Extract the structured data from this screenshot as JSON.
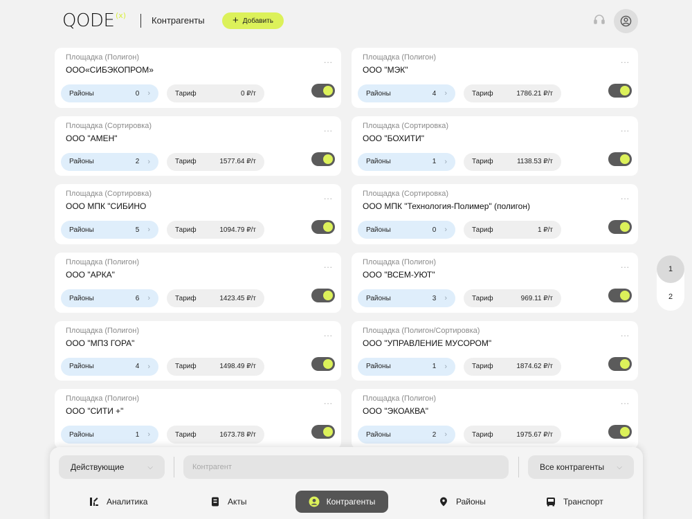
{
  "header": {
    "logo_text": "QODE",
    "logo_sup": "(x)",
    "title": "Контрагенты",
    "add_label": "Добавить"
  },
  "colors": {
    "accent": "#dcf15a",
    "toggle_track": "#5b5b5b",
    "districts_bg": "#dfeefb",
    "tariff_bg": "#efefef",
    "nav_active": "#555555"
  },
  "card_labels": {
    "districts": "Районы",
    "tariff": "Тариф",
    "more": "..."
  },
  "cards": [
    {
      "type": "Площадка (Полигон)",
      "name": "ООО«СИБЭКОПРОМ»",
      "districts": "0",
      "tariff": "0 ₽/т",
      "active": true
    },
    {
      "type": "Площадка (Полигон)",
      "name": "ООО \"МЭК\"",
      "districts": "4",
      "tariff": "1786.21 ₽/т",
      "active": true
    },
    {
      "type": "Площадка (Сортировка)",
      "name": "ООО \"АМЕН\"",
      "districts": "2",
      "tariff": "1577.64 ₽/т",
      "active": true
    },
    {
      "type": "Площадка (Сортировка)",
      "name": "ООО \"БОХИТИ\"",
      "districts": "1",
      "tariff": "1138.53 ₽/т",
      "active": true
    },
    {
      "type": "Площадка (Сортировка)",
      "name": "ООО МПК \"СИБИНО",
      "districts": "5",
      "tariff": "1094.79 ₽/т",
      "active": true
    },
    {
      "type": "Площадка (Сортировка)",
      "name": "ООО МПК \"Технология-Полимер\" (полигон)",
      "districts": "0",
      "tariff": "1 ₽/т",
      "active": true
    },
    {
      "type": "Площадка (Полигон)",
      "name": "ООО \"АРКА\"",
      "districts": "6",
      "tariff": "1423.45 ₽/т",
      "active": true
    },
    {
      "type": "Площадка (Полигон)",
      "name": "ООО \"ВСЕМ-УЮТ\"",
      "districts": "3",
      "tariff": "969.11 ₽/т",
      "active": true
    },
    {
      "type": "Площадка (Полигон)",
      "name": "ООО \"МПЗ ГОРА\"",
      "districts": "4",
      "tariff": "1498.49 ₽/т",
      "active": true
    },
    {
      "type": "Площадка (Полигон/Сортировка)",
      "name": "ООО \"УПРАВЛЕНИЕ МУСОРОМ\"",
      "districts": "1",
      "tariff": "1874.62 ₽/т",
      "active": true
    },
    {
      "type": "Площадка (Полигон)",
      "name": "ООО \"СИТИ +\"",
      "districts": "1",
      "tariff": "1673.78 ₽/т",
      "active": true
    },
    {
      "type": "Площадка (Полигон)",
      "name": "ООО \"ЭКОАКВА\"",
      "districts": "2",
      "tariff": "1975.67 ₽/т",
      "active": true
    }
  ],
  "pagination": {
    "pages": [
      "1",
      "2"
    ],
    "current": "1"
  },
  "filters": {
    "status_value": "Действующие",
    "search_placeholder": "Контрагент",
    "search_value": "",
    "type_value": "Все контрагенты"
  },
  "nav": {
    "items": [
      {
        "label": "Аналитика",
        "icon": "analytics-icon"
      },
      {
        "label": "Акты",
        "icon": "document-icon"
      },
      {
        "label": "Контрагенты",
        "icon": "user-circle-icon",
        "active": true
      },
      {
        "label": "Районы",
        "icon": "map-pin-icon"
      },
      {
        "label": "Транспорт",
        "icon": "bus-icon"
      }
    ]
  }
}
